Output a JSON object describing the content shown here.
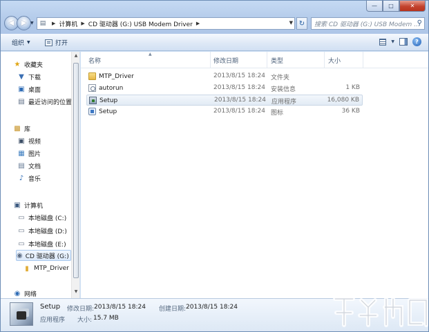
{
  "window": {
    "controls": {
      "minimize": "—",
      "maximize": "□",
      "close": "✕"
    }
  },
  "address": {
    "crumbs": [
      "计算机",
      "CD 驱动器 (G:) USB Modem Driver"
    ],
    "search_placeholder": "搜索 CD 驱动器 (G:) USB Modem ..."
  },
  "toolbar": {
    "organize_label": "组织",
    "open_label": "打开"
  },
  "nav": {
    "favorites": {
      "label": "收藏夹",
      "items": [
        "下载",
        "桌面",
        "最近访问的位置"
      ]
    },
    "libraries": {
      "label": "库",
      "items": [
        "视频",
        "图片",
        "文档",
        "音乐"
      ]
    },
    "computer": {
      "label": "计算机",
      "items": [
        "本地磁盘 (C:)",
        "本地磁盘 (D:)",
        "本地磁盘 (E:)",
        "CD 驱动器 (G:) U",
        "MTP_Driver"
      ]
    },
    "network": {
      "label": "网络"
    }
  },
  "columns": {
    "name": "名称",
    "date": "修改日期",
    "type": "类型",
    "size": "大小"
  },
  "files": [
    {
      "name": "MTP_Driver",
      "date": "2013/8/15 18:24",
      "type": "文件夹",
      "size": "",
      "icon": "folder-icon"
    },
    {
      "name": "autorun",
      "date": "2013/8/15 18:24",
      "type": "安装信息",
      "size": "1 KB",
      "icon": "setup-info-icon"
    },
    {
      "name": "Setup",
      "date": "2013/8/15 18:24",
      "type": "应用程序",
      "size": "16,080 KB",
      "icon": "application-icon"
    },
    {
      "name": "Setup",
      "date": "2013/8/15 18:24",
      "type": "图标",
      "size": "36 KB",
      "icon": "icon-file-icon"
    }
  ],
  "details": {
    "name": "Setup",
    "modified_label": "修改日期:",
    "modified_value": "2013/8/15 18:24",
    "created_label": "创建日期:",
    "created_value": "2013/8/15 18:24",
    "type": "应用程序",
    "size_label": "大小:",
    "size_value": "15.7 MB"
  },
  "colors": {
    "selection": "#dbe9fa",
    "folder": "#e7b847",
    "titlebar": "#b4cbea"
  }
}
